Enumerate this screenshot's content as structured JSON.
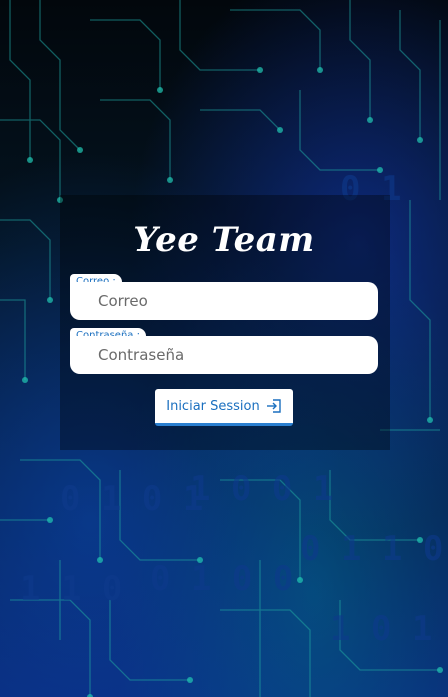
{
  "app": {
    "title": "Yee Team"
  },
  "form": {
    "email_label": "Correo :",
    "email_placeholder": "Correo",
    "email_value": "",
    "password_label": "Contraseña :",
    "password_placeholder": "Contraseña",
    "password_value": "",
    "submit_label": "Iniciar Session",
    "submit_icon": "sign-in-icon"
  },
  "colors": {
    "accent": "#1a6fbf",
    "title": "#ffffff",
    "field_bg": "#ffffff"
  }
}
